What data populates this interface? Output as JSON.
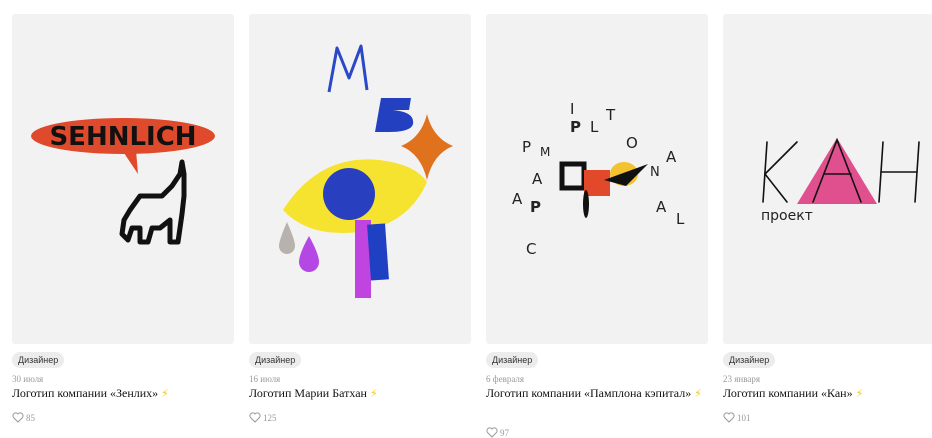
{
  "cards": [
    {
      "badge": "Дизайнер",
      "date": "30 июля",
      "title": "Логотип компании «Зенлих»",
      "likes": "85",
      "logo_text": "SEHNLICH",
      "image_icon": "elephant-speech-bubble-logo"
    },
    {
      "badge": "Дизайнер",
      "date": "16 июля",
      "title": "Логотип Марии Батхан",
      "likes": "125",
      "logo_text": "МБ",
      "image_icon": "abstract-eye-logo"
    },
    {
      "badge": "Дизайнер",
      "date": "6 февраля",
      "title": "Логотип компании «Памплона кэпитал»",
      "likes": "97",
      "logo_text": "PAMPLONA CAPITAL",
      "image_icon": "scattered-letters-logo"
    },
    {
      "badge": "Дизайнер",
      "date": "23 января",
      "title": "Логотип компании «Кан»",
      "likes": "101",
      "logo_text": "КАН",
      "logo_subtext": "проект",
      "image_icon": "pink-triangle-logo"
    }
  ],
  "bolt_icon": "⚡",
  "colors": {
    "thumb_bg": "#f2f2f2",
    "bolt": "#f3c61c",
    "meta_gray": "#9a9a9a"
  }
}
